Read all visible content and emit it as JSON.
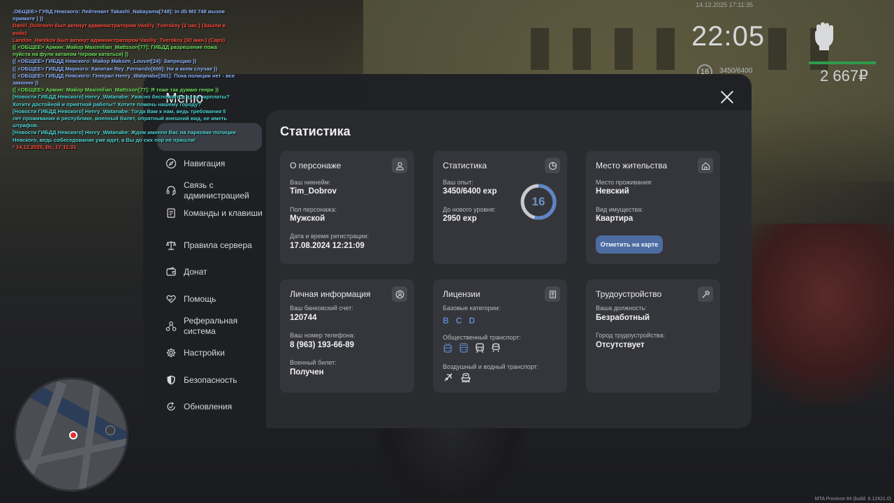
{
  "hud": {
    "date": "14.12.2025 17:11:35",
    "time": "22:05",
    "level": "16",
    "exp": "3450/6400",
    "money": "2 667₽"
  },
  "chat": [
    {
      "text": ".ОБЩЕЕ> ГУВД Невского: Лейтенант Takashi_Nakayama[748]: in db M3 748 вызов примите ) ))",
      "color": "#8fb4ff"
    },
    {
      "text": "Daniil_Dubrovin был заткнут администратором Vasiliy_Tverskoy (2 час.) (Зашли в войс)",
      "color": "#ff4a3d"
    },
    {
      "text": "Landon_Harekov был заткнут администратором Vasiliy_Tverskoy (30 мин.) (Caps)",
      "color": "#ff4a3d"
    },
    {
      "text": "(( <ОБЩЕЕ> Армин: Майор Maximilian_Mattsson[77]: ГИБДД разрешение пожа пуйста на фули катаном Чероки кататься) ))",
      "color": "#6de05c"
    },
    {
      "text": "(( <ОБЩЕЕ> ГИБДД Невского: Майор Maksim_Louvet[24]: Запрещаю ))",
      "color": "#8fb4ff"
    },
    {
      "text": "(( <ОБЩЕЕ> ГИБДД Мирного: Капитан Rey_Fernando[669]: Ни в коем случае ))",
      "color": "#8fb4ff"
    },
    {
      "text": "(( <ОБЩЕЕ> ГИБДД Невского: Генерал Henry_Watanabe[391]: Пока полиции нет - все законно ))",
      "color": "#8fb4ff"
    },
    {
      "text": "(( <ОБЩЕЕ> Армин: Майор Maximilian_Mattsson[77]: Я тоже так думаю генри ))",
      "color": "#6de05c"
    },
    {
      "text": "[Новости ГИБДД Невского] Henry_Watanabe: Ужасно беспокоятся из-за зарплаты? Хотите достойной и приятной работы? Хотите помочь нашему городу?",
      "color": "#4fd6d6"
    },
    {
      "text": "[Новости ГИБДД Невского] Henry_Watanabe: Тогда Вам к нам, ведь требования 5 лет проживания в республике, военный билет, опрятный внешний вид, не иметь штрафов.",
      "color": "#4fd6d6"
    },
    {
      "text": "[Новости ГИБДД Невского] Henry_Watanabe: Ждем именно Вас на парковке полиции Невского, ведь собеседование уже идет, а Вы до сих пор не пришли!",
      "color": "#4fd6d6"
    },
    {
      "text": "* 14.12.2025, Вс, 17:11:31",
      "color": "#ff4a3d"
    }
  ],
  "footer": "MTA Province #4 (build: 6.12421.0)",
  "menu": {
    "title": "Меню",
    "sidebar": [
      {
        "label": "Навигация",
        "icon": "compass-icon"
      },
      {
        "label": "Связь с администрацией",
        "icon": "headset-icon"
      },
      {
        "label": "Команды и клавиши",
        "icon": "document-icon"
      },
      {
        "label": "Правила сервера",
        "icon": "scales-icon"
      },
      {
        "label": "Донат",
        "icon": "wallet-icon"
      },
      {
        "label": "Помощь",
        "icon": "heart-hand-icon"
      },
      {
        "label": "Реферальная система",
        "icon": "network-icon"
      },
      {
        "label": "Настройки",
        "icon": "gear-icon"
      },
      {
        "label": "Безопасность",
        "icon": "shield-icon"
      },
      {
        "label": "Обновления",
        "icon": "refresh-icon"
      }
    ],
    "content_title": "Статистика",
    "cards": {
      "about": {
        "title": "О персонаже",
        "nick_label": "Ваш никнейм:",
        "nick": "Tim_Dobrov",
        "gender_label": "Пол персонажа:",
        "gender": "Мужской",
        "reg_label": "Дата и время регистрации:",
        "reg": "17.08.2024 12:21:09"
      },
      "stats": {
        "title": "Статистика",
        "exp_label": "Ваш опыт:",
        "exp": "3450/6400 exp",
        "next_label": "До нового уровня:",
        "next": "2950 exp",
        "level": "16",
        "progress": 0.539
      },
      "residence": {
        "title": "Место жительства",
        "place_label": "Место проживания:",
        "place": "Невский",
        "property_label": "Вид имущества:",
        "property": "Квартира",
        "button": "Отметить на карте"
      },
      "personal": {
        "title": "Личная информация",
        "bank_label": "Ваш банковский счет:",
        "bank": "120744",
        "phone_label": "Ваш номер телефона:",
        "phone": "8 (963) 193-66-89",
        "military_label": "Военный билет:",
        "military": "Получен"
      },
      "licenses": {
        "title": "Лицензии",
        "base_label": "Базовые категории:",
        "base": [
          "B",
          "C",
          "D"
        ],
        "public_label": "Общественный транспорт:",
        "air_label": "Воздушный и водный транспорт:"
      },
      "job": {
        "title": "Трудоустройство",
        "position_label": "Ваша должность:",
        "position": "Безработный",
        "city_label": "Город трудоустройства:",
        "city": "Отсутствует"
      }
    }
  },
  "colors": {
    "accent": "#4d6ca1",
    "ring": "#5d85c7",
    "hud_bar": "#2e9d4c"
  }
}
